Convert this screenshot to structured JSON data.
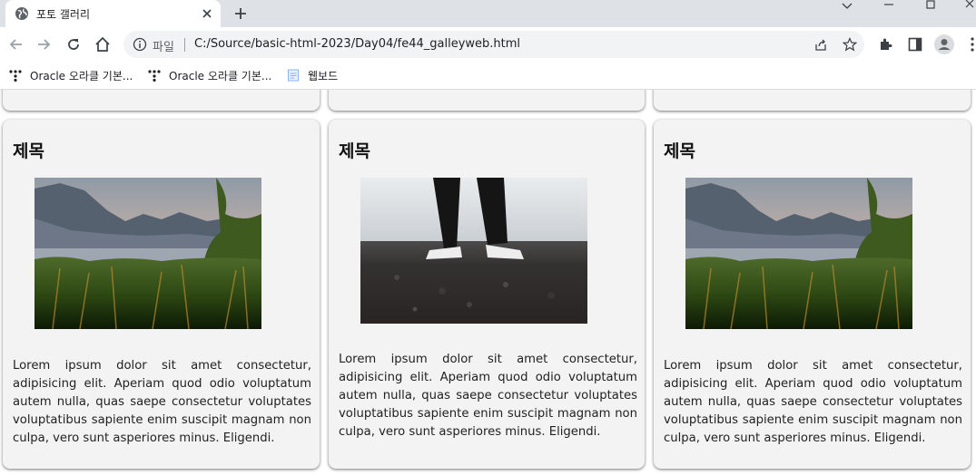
{
  "browser": {
    "tab": {
      "title": "포토 갤러리"
    },
    "address": {
      "scheme_label": "파일",
      "url": "C:/Source/basic-html-2023/Day04/fe44_galleyweb.html"
    },
    "bookmarks": [
      {
        "label": "Oracle 오라클 기본..."
      },
      {
        "label": "Oracle 오라클 기본..."
      },
      {
        "label": "웹보드"
      }
    ]
  },
  "gallery": {
    "cards": [
      {
        "title": "제목",
        "image": "lake-landscape-photo",
        "text": "Lorem ipsum dolor sit amet consectetur, adipisicing elit. Aperiam quod odio voluptatum autem nulla, quas saepe consectetur voluptates voluptatibus sapiente enim suscipit magnam non culpa, vero sunt asperiores minus. Eligendi."
      },
      {
        "title": "제목",
        "image": "person-feet-photo",
        "text": "Lorem ipsum dolor sit amet consectetur, adipisicing elit. Aperiam quod odio voluptatum autem nulla, quas saepe consectetur voluptates voluptatibus sapiente enim suscipit magnam non culpa, vero sunt asperiores minus. Eligendi."
      },
      {
        "title": "제목",
        "image": "lake-landscape-photo",
        "text": "Lorem ipsum dolor sit amet consectetur, adipisicing elit. Aperiam quod odio voluptatum autem nulla, quas saepe consectetur voluptates voluptatibus sapiente enim suscipit magnam non culpa, vero sunt asperiores minus. Eligendi."
      }
    ]
  }
}
